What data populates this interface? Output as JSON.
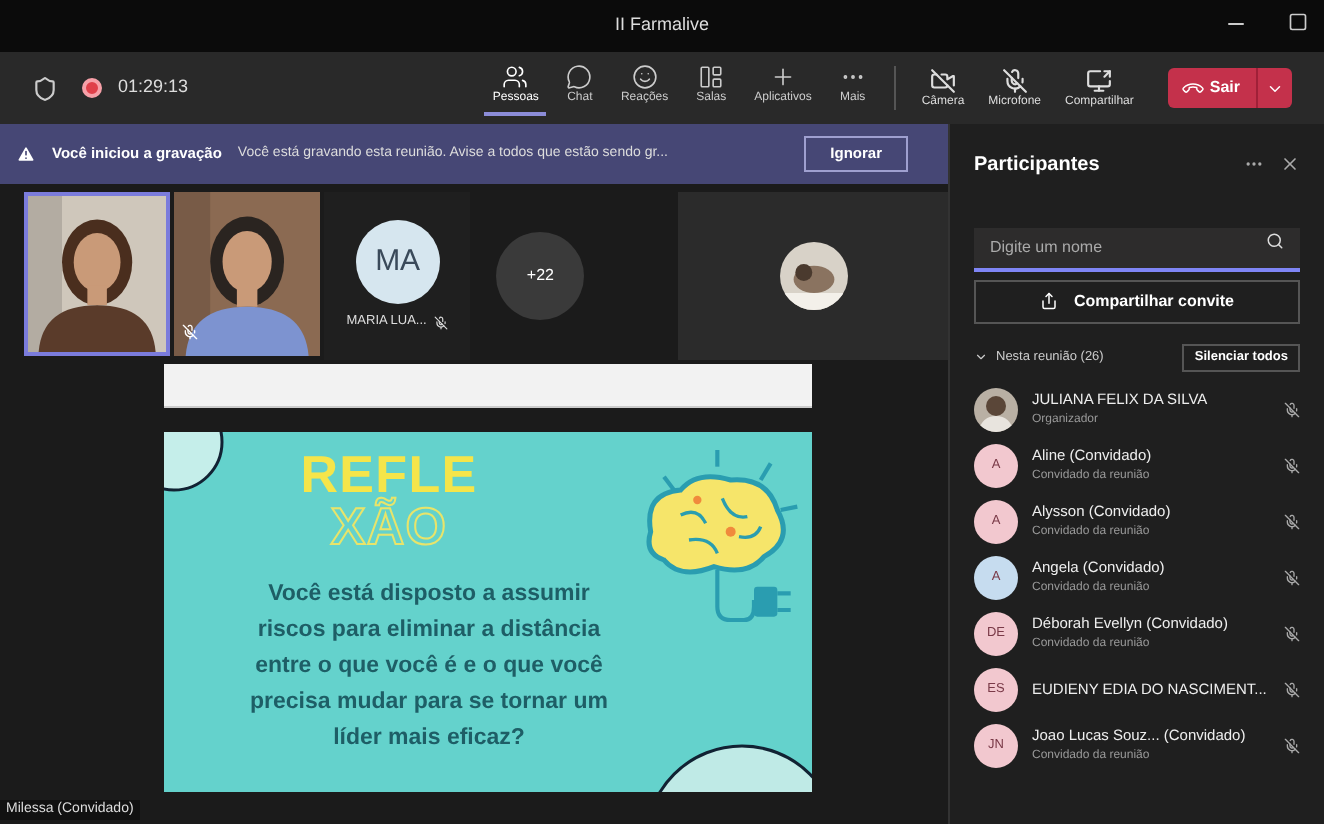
{
  "window": {
    "title": "II Farmalive"
  },
  "meeting": {
    "timer": "01:29:13",
    "recording": true
  },
  "toolbar": [
    {
      "kind": "people",
      "label": "Pessoas",
      "selected": true
    },
    {
      "kind": "chat",
      "label": "Chat",
      "selected": false
    },
    {
      "kind": "reactions",
      "label": "Reações",
      "selected": false
    },
    {
      "kind": "rooms",
      "label": "Salas",
      "selected": false
    },
    {
      "kind": "apps",
      "label": "Aplicativos",
      "selected": false
    },
    {
      "kind": "more",
      "label": "Mais",
      "selected": false
    }
  ],
  "media_controls": [
    {
      "kind": "camera",
      "label": "Câmera"
    },
    {
      "kind": "mic",
      "label": "Microfone"
    },
    {
      "kind": "share",
      "label": "Compartilhar"
    }
  ],
  "leave_button": "Sair",
  "banner": {
    "title": "Você iniciou a gravação",
    "text": "Você está gravando esta reunião. Avise a todos que estão sendo gr...",
    "button": "Ignorar"
  },
  "video_tiles": [
    {
      "kind": "video",
      "active": true
    },
    {
      "kind": "video",
      "active": false,
      "muted": true
    },
    {
      "kind": "initials",
      "initials": "MA",
      "name": "MARIA LUA...",
      "muted": true
    },
    {
      "kind": "overflow",
      "count": "+22"
    },
    {
      "kind": "avatar"
    }
  ],
  "shared_screen": {
    "slide_title_top": "REFLE",
    "slide_title_bottom": "XÃO",
    "slide_text": "Você está disposto a assumir riscos para eliminar a distância entre o que você é e o que você precisa mudar para se tornar um líder mais eficaz?"
  },
  "presenter_label": "Milessa (Convidado)",
  "panel": {
    "title": "Participantes",
    "search": {
      "placeholder": "Digite um nome"
    },
    "invite_button": "Compartilhar convite",
    "section": "Nesta reunião (26)",
    "mute_all_button": "Silenciar todos",
    "participants": [
      {
        "name": "JULIANA FELIX DA SILVA",
        "role": "Organizador"
      },
      {
        "kind": "initials",
        "initials": "A",
        "color": "#f2c8cf",
        "name": "Aline (Convidado)",
        "role": "Convidado da reunião"
      },
      {
        "kind": "initials",
        "initials": "A",
        "color": "#f2c8cf",
        "name": "Alysson (Convidado)",
        "role": "Convidado da reunião"
      },
      {
        "kind": "initials",
        "initials": "A",
        "color": "#c6dcef",
        "name": "Angela (Convidado)",
        "role": "Convidado da reunião"
      },
      {
        "kind": "initials",
        "initials": "DE",
        "color": "#f2c8cf",
        "name": "Déborah Evellyn (Convidado)",
        "role": "Convidado da reunião"
      },
      {
        "kind": "initials",
        "initials": "ES",
        "color": "#f2c8cf",
        "name": "EUDIENY EDIA DO NASCIMENT..."
      },
      {
        "kind": "initials",
        "initials": "JN",
        "color": "#f2c8cf",
        "name": "Joao Lucas Souz... (Convidado)",
        "role": "Convidado da reunião"
      }
    ]
  }
}
